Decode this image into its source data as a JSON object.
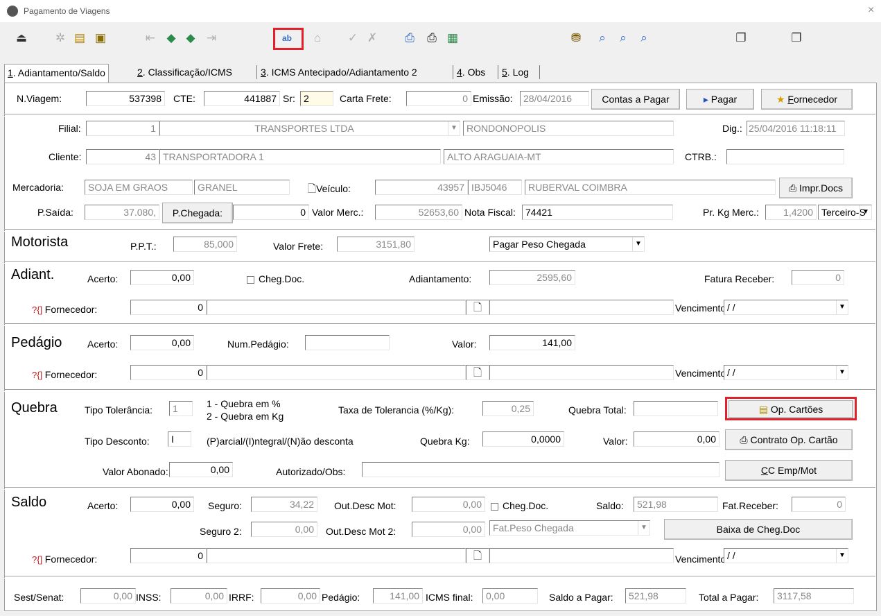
{
  "window": {
    "title": "Pagamento de Viagens",
    "close": "×"
  },
  "toolbar": {
    "icons": [
      "exit-icon",
      "new-icon",
      "open-icon",
      "edit-icon",
      "first-icon",
      "prev-icon",
      "next-icon",
      "last-icon",
      "ab-icon",
      "delete-icon",
      "confirm-icon",
      "cancel-icon",
      "preview-icon",
      "print-icon",
      "calculator-icon",
      "filter-icon",
      "search-icon",
      "search-next-icon",
      "search-prev-icon",
      "copy-icon",
      "paste-icon"
    ]
  },
  "tabs": [
    {
      "key": "1",
      "label": ". Adiantamento/Saldo"
    },
    {
      "key": "2",
      "label": ". Classificação/ICMS"
    },
    {
      "key": "3",
      "label": ". ICMS Antecipado/Adiantamento 2"
    },
    {
      "key": "4",
      "label": ". Obs"
    },
    {
      "key": "5",
      "label": ". Log"
    }
  ],
  "header": {
    "nviagem_label": "N.Viagem:",
    "nviagem": "537398",
    "cte_label": "CTE:",
    "cte": "441887",
    "sr_label": "Sr:",
    "sr": "2",
    "carta_label": "Carta Frete:",
    "carta": "0",
    "emissao_label": "Emissão:",
    "emissao": "28/04/2016",
    "contas_btn": "Contas a Pagar",
    "pagar_btn": "Pagar",
    "fornecedor_btn_key": "F",
    "fornecedor_btn_rest": "ornecedor"
  },
  "info": {
    "filial_label": "Filial:",
    "filial_code": "1",
    "filial_name": "TRANSPORTES LTDA",
    "filial_city": "RONDONOPOLIS",
    "dig_label": "Dig.:",
    "dig": "25/04/2016 11:18:11",
    "cliente_label": "Cliente:",
    "cliente_code": "43",
    "cliente_name": "TRANSPORTADORA 1",
    "cliente_city": "ALTO ARAGUAIA-MT",
    "ctrb_label": "CTRB.:",
    "ctrb": "",
    "mercadoria_label": "Mercadoria:",
    "mercadoria": "SOJA EM GRAOS",
    "mercadoria_tipo": "GRANEL",
    "veiculo_label": "Veículo:",
    "veiculo_code": "43957",
    "placa": "IBJ5046",
    "motorista": "RUBERVAL COIMBRA",
    "impr_btn": "Impr.Docs",
    "psaida_label": "P.Saída:",
    "psaida": "37.080,",
    "pchegada_btn": "P.Chegada:",
    "pchegada": "0",
    "valor_merc_label": "Valor Merc.:",
    "valor_merc": "52653,60",
    "nota_label": "Nota Fiscal:",
    "nota": "74421",
    "prkg_label": "Pr. Kg Merc.:",
    "prkg": "1,4200",
    "tipo": "Terceiro-S"
  },
  "motorista": {
    "title": "Motorista",
    "ppt_label": "P.P.T.:",
    "ppt": "85,000",
    "valor_frete_label": "Valor Frete:",
    "valor_frete": "3151,80",
    "modo": "Pagar Peso Chegada"
  },
  "adiant": {
    "title": "Adiant.",
    "acerto_label": "Acerto:",
    "acerto": "0,00",
    "cheg_label": "Cheg.Doc.",
    "adiantamento_label": "Adiantamento:",
    "adiantamento": "2595,60",
    "fatura_label": "Fatura Receber:",
    "fatura": "0",
    "fornecedor_label": "Fornecedor:",
    "fornecedor": "0",
    "vencimento_label": "Vencimento:",
    "vencimento": "/ /"
  },
  "pedagio": {
    "title": "Pedágio",
    "acerto_label": "Acerto:",
    "acerto": "0,00",
    "num_label": "Num.Pedágio:",
    "num": "",
    "valor_label": "Valor:",
    "valor": "141,00",
    "fornecedor_label": "Fornecedor:",
    "fornecedor": "0",
    "vencimento_label": "Vencimento:",
    "vencimento": "/ /"
  },
  "quebra": {
    "title": "Quebra",
    "tipo_tol_label": "Tipo Tolerância:",
    "tipo_tol": "1",
    "legend1": "1 - Quebra em %",
    "legend2": "2 - Quebra em Kg",
    "taxa_label": "Taxa de Tolerancia (%/Kg):",
    "taxa": "0,25",
    "total_label": "Quebra Total:",
    "total": "",
    "op_btn": "Op. Cartões",
    "tipo_desc_label": "Tipo Desconto:",
    "tipo_desc": "I",
    "desc_legend": "(P)arcial/(I)ntegral/(N)ão desconta",
    "kg_label": "Quebra Kg:",
    "kg": "0,0000",
    "valor_label": "Valor:",
    "valor": "0,00",
    "contrato_btn": "Contrato Op. Cartão",
    "abonado_label": "Valor Abonado:",
    "abonado": "0,00",
    "obs_label": "Autorizado/Obs:",
    "obs": "",
    "cc_btn_key": "C",
    "cc_btn_rest": "C Emp/Mot"
  },
  "saldo": {
    "title": "Saldo",
    "acerto_label": "Acerto:",
    "acerto": "0,00",
    "seguro_label": "Seguro:",
    "seguro": "34,22",
    "outdesc_label": "Out.Desc Mot:",
    "outdesc": "0,00",
    "cheg_label": "Cheg.Doc.",
    "saldo_label": "Saldo:",
    "saldo": "521,98",
    "fat_label": "Fat.Receber:",
    "fat": "0",
    "seguro2_label": "Seguro 2:",
    "seguro2": "0,00",
    "outdesc2_label": "Out.Desc Mot 2:",
    "outdesc2": "0,00",
    "fat_peso": "Fat.Peso Chegada",
    "baixa_btn": "Baixa de Cheg.Doc",
    "fornecedor_label": "Fornecedor:",
    "fornecedor": "0",
    "vencimento_label": "Vencimento:",
    "vencimento": "/ /"
  },
  "totais": {
    "sest_label": "Sest/Senat:",
    "sest": "0,00",
    "inss_label": "INSS:",
    "inss": "0,00",
    "irrf_label": "IRRF:",
    "irrf": "0,00",
    "pedagio_label": "Pedágio:",
    "pedagio": "141,00",
    "icms_label": "ICMS final:",
    "icms": "0,00",
    "saldo_pagar_label": "Saldo a Pagar:",
    "saldo_pagar": "521,98",
    "total_pagar_label": "Total a Pagar:",
    "total_pagar": "3117,58"
  },
  "colors": {
    "highlight": "#e0202a",
    "panel": "#ffffff",
    "bg": "#f0f0f0"
  }
}
